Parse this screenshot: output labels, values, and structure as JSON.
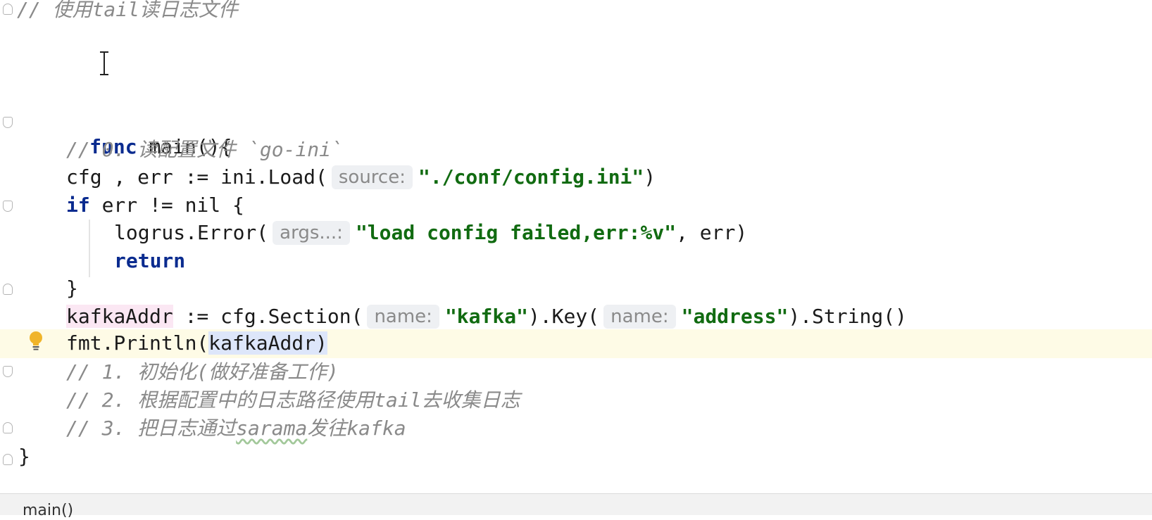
{
  "editor": {
    "language": "Go",
    "lines": [
      {
        "comment": "// 使用tail读日志文件"
      },
      {
        "kw": "func",
        "text": " main(){"
      },
      {
        "comment": "// 0. 读配置文件 `go-ini`"
      },
      {
        "pre": "cfg , err := ini.Load(",
        "hint": "source:",
        "str": "\"./conf/config.ini\"",
        "post": ")"
      },
      {
        "kw": "if",
        "text": " err != nil {"
      },
      {
        "pre": "logrus.Error(",
        "hint": "args...:",
        "str": "\"load config failed,err:%v\"",
        "post": ", err)"
      },
      {
        "kw": "return"
      },
      {
        "text": "}"
      },
      {
        "var": "kafkaAddr",
        "pre": " := cfg.Section(",
        "hint1": "name:",
        "str1": "\"kafka\"",
        "mid": ").Key(",
        "hint2": "name:",
        "str2": "\"address\"",
        "post": ").String()"
      },
      {
        "pre": "fmt.Println(",
        "sel": "kafkaAddr)"
      },
      {
        "comment": "// 1. 初始化(做好准备工作)"
      },
      {
        "comment": "// 2. 根据配置中的日志路径使用tail去收集日志"
      },
      {
        "comment_pre": "// 3. 把日志通过",
        "comment_wavy": "sarama",
        "comment_post": "发往kafka"
      },
      {
        "text": "}"
      }
    ]
  },
  "status": {
    "breadcrumb": "main()"
  },
  "colors": {
    "keyword": "#0a2b8f",
    "string": "#116b11",
    "comment": "#8a8a8a",
    "current_line": "#fefbe6",
    "bulb": "#f0b429"
  },
  "icons": [
    "text-cursor-icon",
    "intention-bulb-icon",
    "fold-marker-icon"
  ]
}
